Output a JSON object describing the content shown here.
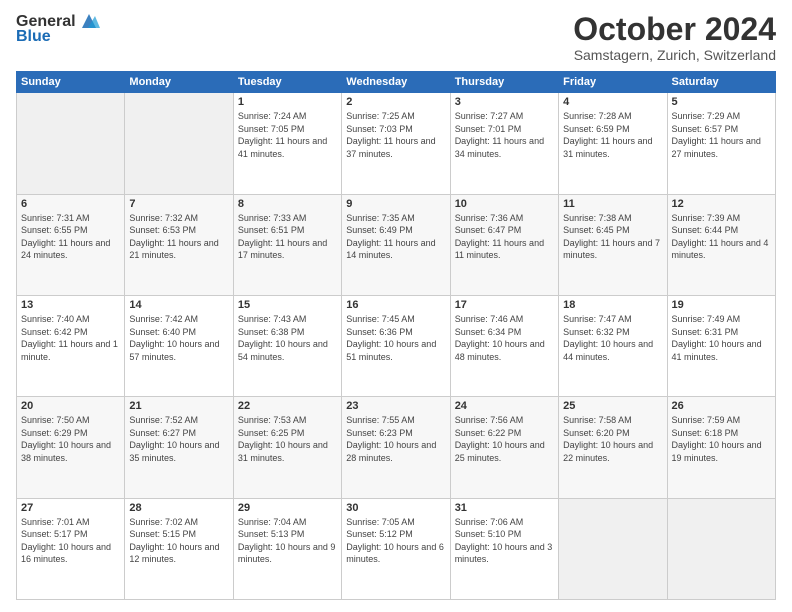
{
  "header": {
    "logo_general": "General",
    "logo_blue": "Blue",
    "month_title": "October 2024",
    "subtitle": "Samstagern, Zurich, Switzerland"
  },
  "weekdays": [
    "Sunday",
    "Monday",
    "Tuesday",
    "Wednesday",
    "Thursday",
    "Friday",
    "Saturday"
  ],
  "rows": [
    [
      {
        "day": "",
        "info": ""
      },
      {
        "day": "",
        "info": ""
      },
      {
        "day": "1",
        "info": "Sunrise: 7:24 AM\nSunset: 7:05 PM\nDaylight: 11 hours and 41 minutes."
      },
      {
        "day": "2",
        "info": "Sunrise: 7:25 AM\nSunset: 7:03 PM\nDaylight: 11 hours and 37 minutes."
      },
      {
        "day": "3",
        "info": "Sunrise: 7:27 AM\nSunset: 7:01 PM\nDaylight: 11 hours and 34 minutes."
      },
      {
        "day": "4",
        "info": "Sunrise: 7:28 AM\nSunset: 6:59 PM\nDaylight: 11 hours and 31 minutes."
      },
      {
        "day": "5",
        "info": "Sunrise: 7:29 AM\nSunset: 6:57 PM\nDaylight: 11 hours and 27 minutes."
      }
    ],
    [
      {
        "day": "6",
        "info": "Sunrise: 7:31 AM\nSunset: 6:55 PM\nDaylight: 11 hours and 24 minutes."
      },
      {
        "day": "7",
        "info": "Sunrise: 7:32 AM\nSunset: 6:53 PM\nDaylight: 11 hours and 21 minutes."
      },
      {
        "day": "8",
        "info": "Sunrise: 7:33 AM\nSunset: 6:51 PM\nDaylight: 11 hours and 17 minutes."
      },
      {
        "day": "9",
        "info": "Sunrise: 7:35 AM\nSunset: 6:49 PM\nDaylight: 11 hours and 14 minutes."
      },
      {
        "day": "10",
        "info": "Sunrise: 7:36 AM\nSunset: 6:47 PM\nDaylight: 11 hours and 11 minutes."
      },
      {
        "day": "11",
        "info": "Sunrise: 7:38 AM\nSunset: 6:45 PM\nDaylight: 11 hours and 7 minutes."
      },
      {
        "day": "12",
        "info": "Sunrise: 7:39 AM\nSunset: 6:44 PM\nDaylight: 11 hours and 4 minutes."
      }
    ],
    [
      {
        "day": "13",
        "info": "Sunrise: 7:40 AM\nSunset: 6:42 PM\nDaylight: 11 hours and 1 minute."
      },
      {
        "day": "14",
        "info": "Sunrise: 7:42 AM\nSunset: 6:40 PM\nDaylight: 10 hours and 57 minutes."
      },
      {
        "day": "15",
        "info": "Sunrise: 7:43 AM\nSunset: 6:38 PM\nDaylight: 10 hours and 54 minutes."
      },
      {
        "day": "16",
        "info": "Sunrise: 7:45 AM\nSunset: 6:36 PM\nDaylight: 10 hours and 51 minutes."
      },
      {
        "day": "17",
        "info": "Sunrise: 7:46 AM\nSunset: 6:34 PM\nDaylight: 10 hours and 48 minutes."
      },
      {
        "day": "18",
        "info": "Sunrise: 7:47 AM\nSunset: 6:32 PM\nDaylight: 10 hours and 44 minutes."
      },
      {
        "day": "19",
        "info": "Sunrise: 7:49 AM\nSunset: 6:31 PM\nDaylight: 10 hours and 41 minutes."
      }
    ],
    [
      {
        "day": "20",
        "info": "Sunrise: 7:50 AM\nSunset: 6:29 PM\nDaylight: 10 hours and 38 minutes."
      },
      {
        "day": "21",
        "info": "Sunrise: 7:52 AM\nSunset: 6:27 PM\nDaylight: 10 hours and 35 minutes."
      },
      {
        "day": "22",
        "info": "Sunrise: 7:53 AM\nSunset: 6:25 PM\nDaylight: 10 hours and 31 minutes."
      },
      {
        "day": "23",
        "info": "Sunrise: 7:55 AM\nSunset: 6:23 PM\nDaylight: 10 hours and 28 minutes."
      },
      {
        "day": "24",
        "info": "Sunrise: 7:56 AM\nSunset: 6:22 PM\nDaylight: 10 hours and 25 minutes."
      },
      {
        "day": "25",
        "info": "Sunrise: 7:58 AM\nSunset: 6:20 PM\nDaylight: 10 hours and 22 minutes."
      },
      {
        "day": "26",
        "info": "Sunrise: 7:59 AM\nSunset: 6:18 PM\nDaylight: 10 hours and 19 minutes."
      }
    ],
    [
      {
        "day": "27",
        "info": "Sunrise: 7:01 AM\nSunset: 5:17 PM\nDaylight: 10 hours and 16 minutes."
      },
      {
        "day": "28",
        "info": "Sunrise: 7:02 AM\nSunset: 5:15 PM\nDaylight: 10 hours and 12 minutes."
      },
      {
        "day": "29",
        "info": "Sunrise: 7:04 AM\nSunset: 5:13 PM\nDaylight: 10 hours and 9 minutes."
      },
      {
        "day": "30",
        "info": "Sunrise: 7:05 AM\nSunset: 5:12 PM\nDaylight: 10 hours and 6 minutes."
      },
      {
        "day": "31",
        "info": "Sunrise: 7:06 AM\nSunset: 5:10 PM\nDaylight: 10 hours and 3 minutes."
      },
      {
        "day": "",
        "info": ""
      },
      {
        "day": "",
        "info": ""
      }
    ]
  ]
}
